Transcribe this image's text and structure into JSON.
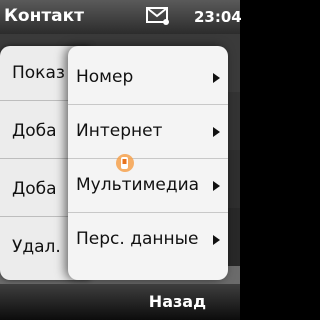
{
  "status": {
    "title": "Контакт",
    "time": "23:04"
  },
  "options_menu": {
    "items": [
      {
        "label": "Показ"
      },
      {
        "label": "Доба"
      },
      {
        "label": "Доба"
      },
      {
        "label": "Удал."
      }
    ]
  },
  "submenu": {
    "items": [
      {
        "label": "Номер"
      },
      {
        "label": "Интернет"
      },
      {
        "label": "Мультимедиа"
      },
      {
        "label": "Перс. данные"
      }
    ]
  },
  "softkeys": {
    "right": "Назад"
  },
  "colors": {
    "menu_bg": "#f4f4f4",
    "statusbar": "#3a3a3a",
    "accent": "#e8731c"
  }
}
